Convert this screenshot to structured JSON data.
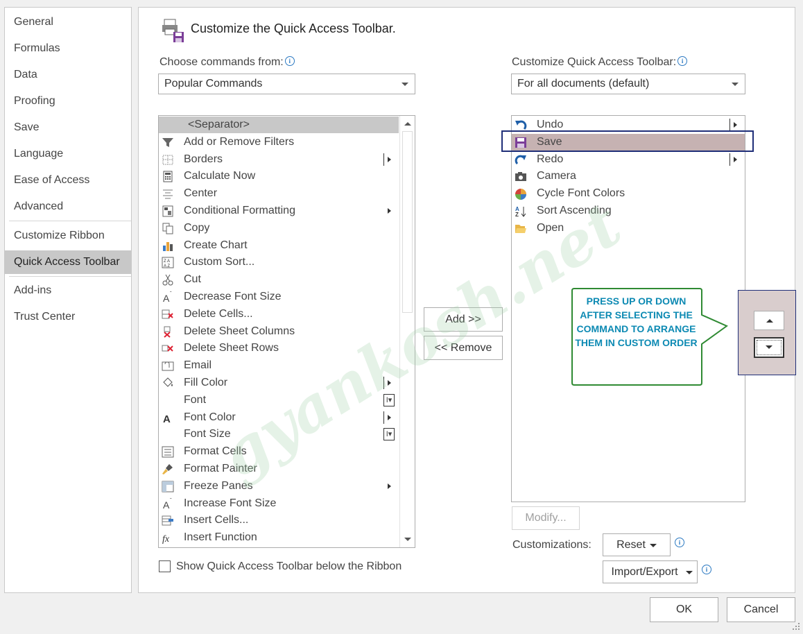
{
  "nav": {
    "items": [
      "General",
      "Formulas",
      "Data",
      "Proofing",
      "Save",
      "Language",
      "Ease of Access",
      "Advanced",
      "Customize Ribbon",
      "Quick Access Toolbar",
      "Add-ins",
      "Trust Center"
    ],
    "selected": "Quick Access Toolbar"
  },
  "header": {
    "title": "Customize the Quick Access Toolbar."
  },
  "left": {
    "choose_label": "Choose commands from:",
    "choose_value": "Popular Commands",
    "commands": [
      {
        "label": "<Separator>",
        "icon": "separator"
      },
      {
        "label": "Add or Remove Filters",
        "icon": "filter-icon"
      },
      {
        "label": "Borders",
        "icon": "borders-icon",
        "sub": "split"
      },
      {
        "label": "Calculate Now",
        "icon": "calculator-icon"
      },
      {
        "label": "Center",
        "icon": "center-align-icon"
      },
      {
        "label": "Conditional Formatting",
        "icon": "conditional-formatting-icon",
        "sub": "arrow"
      },
      {
        "label": "Copy",
        "icon": "copy-icon"
      },
      {
        "label": "Create Chart",
        "icon": "chart-icon"
      },
      {
        "label": "Custom Sort...",
        "icon": "sort-icon"
      },
      {
        "label": "Cut",
        "icon": "scissors-icon"
      },
      {
        "label": "Decrease Font Size",
        "icon": "decrease-font-icon"
      },
      {
        "label": "Delete Cells...",
        "icon": "delete-cells-icon"
      },
      {
        "label": "Delete Sheet Columns",
        "icon": "delete-columns-icon"
      },
      {
        "label": "Delete Sheet Rows",
        "icon": "delete-rows-icon"
      },
      {
        "label": "Email",
        "icon": "email-icon"
      },
      {
        "label": "Fill Color",
        "icon": "fill-color-icon",
        "sub": "split"
      },
      {
        "label": "Font",
        "icon": "none",
        "sub": "textbox"
      },
      {
        "label": "Font Color",
        "icon": "font-color-icon",
        "sub": "split"
      },
      {
        "label": "Font Size",
        "icon": "none",
        "sub": "textbox"
      },
      {
        "label": "Format Cells",
        "icon": "format-cells-icon"
      },
      {
        "label": "Format Painter",
        "icon": "paintbrush-icon"
      },
      {
        "label": "Freeze Panes",
        "icon": "freeze-panes-icon",
        "sub": "arrow"
      },
      {
        "label": "Increase Font Size",
        "icon": "increase-font-icon"
      },
      {
        "label": "Insert Cells...",
        "icon": "insert-cells-icon"
      },
      {
        "label": "Insert Function",
        "icon": "function-icon"
      }
    ],
    "show_below_label": "Show Quick Access Toolbar below the Ribbon"
  },
  "middle": {
    "add_label": "Add >>",
    "remove_label": "<< Remove"
  },
  "right": {
    "customize_label": "Customize Quick Access Toolbar:",
    "customize_value": "For all documents (default)",
    "items": [
      {
        "label": "Undo",
        "icon": "undo-icon",
        "sub": "split"
      },
      {
        "label": "Save",
        "icon": "save-icon",
        "selected": true
      },
      {
        "label": "Redo",
        "icon": "redo-icon",
        "sub": "split"
      },
      {
        "label": "Camera",
        "icon": "camera-icon"
      },
      {
        "label": "Cycle Font Colors",
        "icon": "cycle-colors-icon"
      },
      {
        "label": "Sort Ascending",
        "icon": "sort-ascending-icon"
      },
      {
        "label": "Open",
        "icon": "folder-open-icon"
      }
    ],
    "modify_label": "Modify...",
    "customizations_label": "Customizations:",
    "reset_label": "Reset",
    "import_export_label": "Import/Export"
  },
  "callout": {
    "text": "PRESS UP OR DOWN AFTER SELECTING THE COMMAND TO ARRANGE THEM IN CUSTOM ORDER"
  },
  "watermark": "gyankosh.net",
  "footer": {
    "ok_label": "OK",
    "cancel_label": "Cancel"
  },
  "colors": {
    "selected_row": "#c6b2b2",
    "highlight_border": "#1f2e78",
    "callout_border": "#2f8a33",
    "callout_text": "#0d8ab3",
    "nav_selected": "#c8c8c8"
  }
}
